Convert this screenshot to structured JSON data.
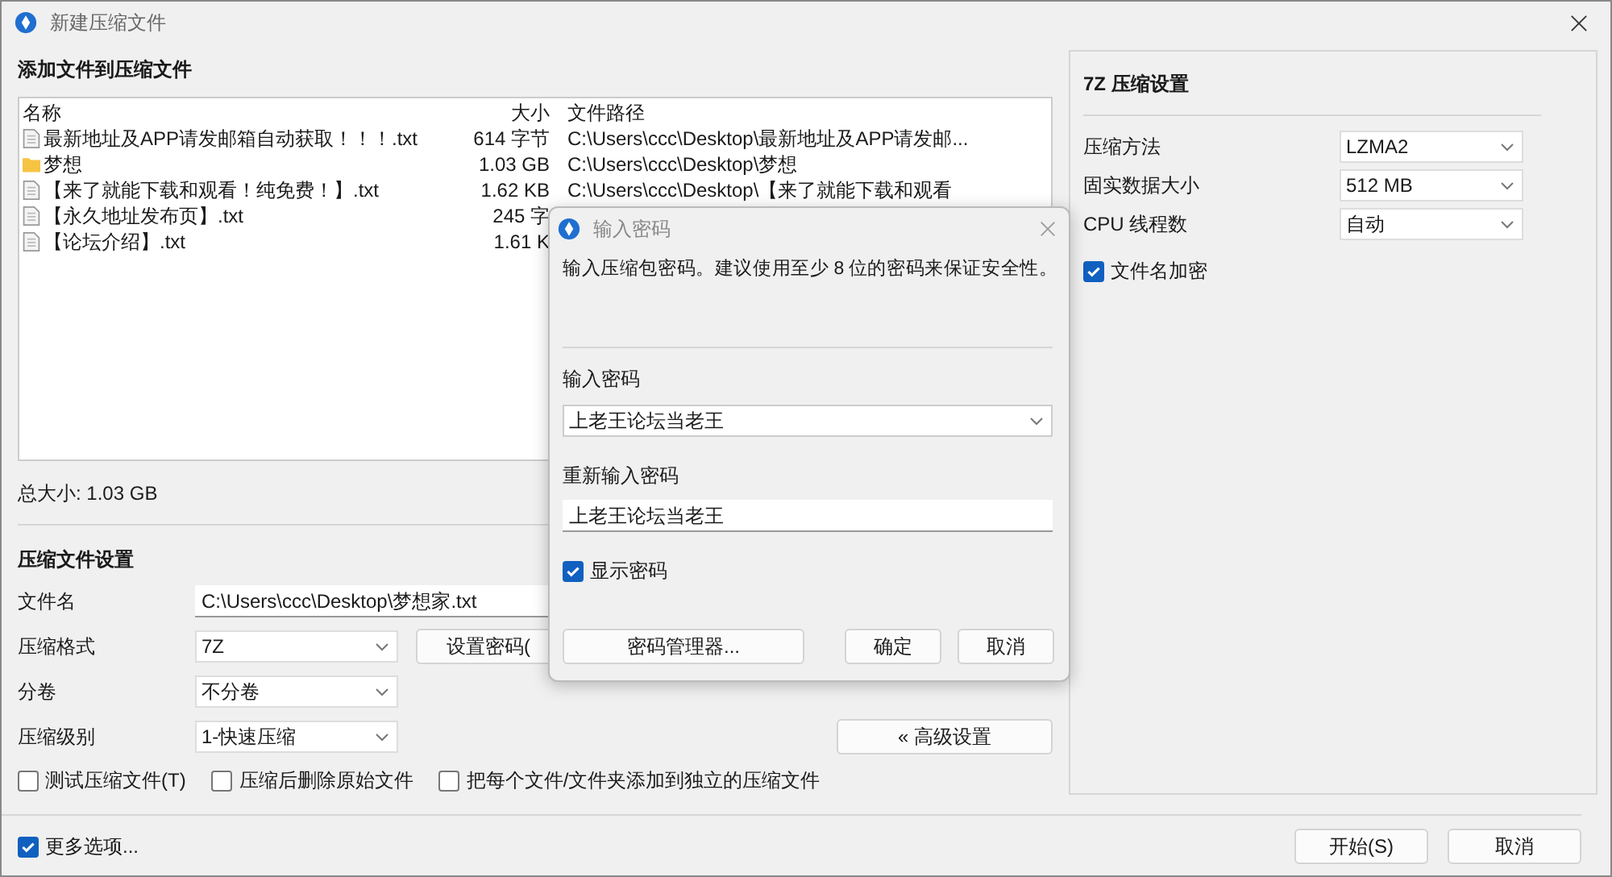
{
  "window": {
    "title": "新建压缩文件"
  },
  "files": {
    "heading": "添加文件到压缩文件",
    "columns": [
      "名称",
      "大小",
      "文件路径"
    ],
    "rows": [
      {
        "kind": "file",
        "name": "最新地址及APP请发邮箱自动获取！！！.txt",
        "size": "614 字节",
        "path": "C:\\Users\\ccc\\Desktop\\最新地址及APP请发邮..."
      },
      {
        "kind": "folder",
        "name": "梦想",
        "size": "1.03 GB",
        "path": "C:\\Users\\ccc\\Desktop\\梦想"
      },
      {
        "kind": "file",
        "name": "【来了就能下载和观看！纯免费！】.txt",
        "size": "1.62 KB",
        "path": "C:\\Users\\ccc\\Desktop\\【来了就能下载和观看"
      },
      {
        "kind": "file",
        "name": "【永久地址发布页】.txt",
        "size": "245 字",
        "path": ""
      },
      {
        "kind": "file",
        "name": "【论坛介绍】.txt",
        "size": "1.61 K",
        "path": ""
      }
    ],
    "total": "总大小: 1.03 GB"
  },
  "archive": {
    "heading": "压缩文件设置",
    "filename": {
      "label": "文件名",
      "value": "C:\\Users\\ccc\\Desktop\\梦想家.txt"
    },
    "format": {
      "label": "压缩格式",
      "value": "7Z"
    },
    "set_password_button": "设置密码(",
    "split": {
      "label": "分卷",
      "value": "不分卷"
    },
    "level": {
      "label": "压缩级别",
      "value": "1-快速压缩"
    },
    "advanced_button": "« 高级设置",
    "options": [
      {
        "label": "测试压缩文件(T)",
        "checked": false
      },
      {
        "label": "压缩后删除原始文件",
        "checked": false
      },
      {
        "label": "把每个文件/文件夹添加到独立的压缩文件",
        "checked": false
      }
    ]
  },
  "seven_zip": {
    "heading": "7Z 压缩设置",
    "fields": [
      {
        "label": "压缩方法",
        "value": "LZMA2"
      },
      {
        "label": "固实数据大小",
        "value": "512 MB"
      },
      {
        "label": "CPU 线程数",
        "value": "自动"
      }
    ],
    "encrypt_names": {
      "label": "文件名加密",
      "checked": true
    }
  },
  "footer": {
    "more_options": {
      "label": "更多选项...",
      "checked": true
    },
    "buttons": [
      "开始(S)",
      "取消"
    ]
  },
  "password_dialog": {
    "title": "输入密码",
    "message": "输入压缩包密码。建议使用至少 8 位的密码来保证安全性。",
    "password_label": "输入密码",
    "password": "上老王论坛当老王",
    "confirm_label": "重新输入密码",
    "confirm": "上老王论坛当老王",
    "show_password": {
      "label": "显示密码",
      "checked": true
    },
    "buttons": [
      "密码管理器...",
      "确定",
      "取消"
    ]
  }
}
